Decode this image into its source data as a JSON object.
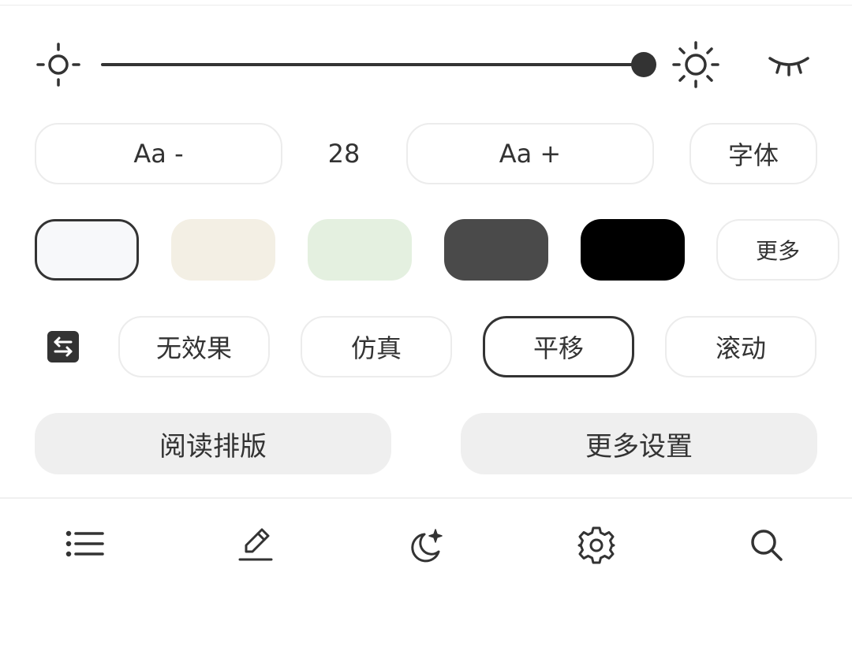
{
  "brightness": {
    "level_percent": 100
  },
  "font_size": {
    "decrease_label": "Aa -",
    "value": "28",
    "increase_label": "Aa +",
    "font_label": "字体"
  },
  "themes": {
    "swatches": [
      {
        "color": "#f7f8fa",
        "selected": true
      },
      {
        "color": "#f3efe4",
        "selected": false
      },
      {
        "color": "#e4f0e0",
        "selected": false
      },
      {
        "color": "#4a4a4a",
        "selected": false
      },
      {
        "color": "#000000",
        "selected": false
      }
    ],
    "more_label": "更多"
  },
  "page_turn": {
    "modes": [
      "无效果",
      "仿真",
      "平移",
      "滚动"
    ],
    "selected": "平移"
  },
  "actions": {
    "layout_label": "阅读排版",
    "more_settings_label": "更多设置"
  },
  "toolbar": {
    "icons": [
      "list-icon",
      "pencil-icon",
      "night-mode-icon",
      "gear-icon",
      "search-icon"
    ]
  },
  "colors": {
    "accent": "#333333",
    "border": "#ececec",
    "button_bg": "#efefef"
  }
}
